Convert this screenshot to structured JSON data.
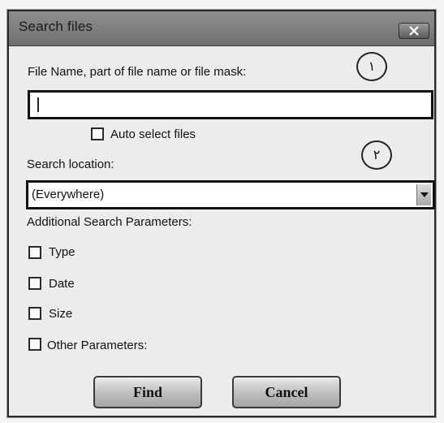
{
  "window": {
    "title": "Search files",
    "close_icon": "close-icon"
  },
  "file_name": {
    "label": "File Name, part of file name or file mask:",
    "value": "",
    "marker": "١"
  },
  "auto_select": {
    "label": "Auto select files",
    "checked": false
  },
  "search_location": {
    "label": "Search location:",
    "value": "(Everywhere)",
    "marker": "٢"
  },
  "additional": {
    "heading": "Additional Search Parameters:",
    "options": [
      {
        "label": "Type",
        "checked": false
      },
      {
        "label": "Date",
        "checked": false
      },
      {
        "label": "Size",
        "checked": false
      },
      {
        "label": "Other Parameters:",
        "checked": false
      }
    ]
  },
  "buttons": {
    "find": "Find",
    "cancel": "Cancel"
  }
}
